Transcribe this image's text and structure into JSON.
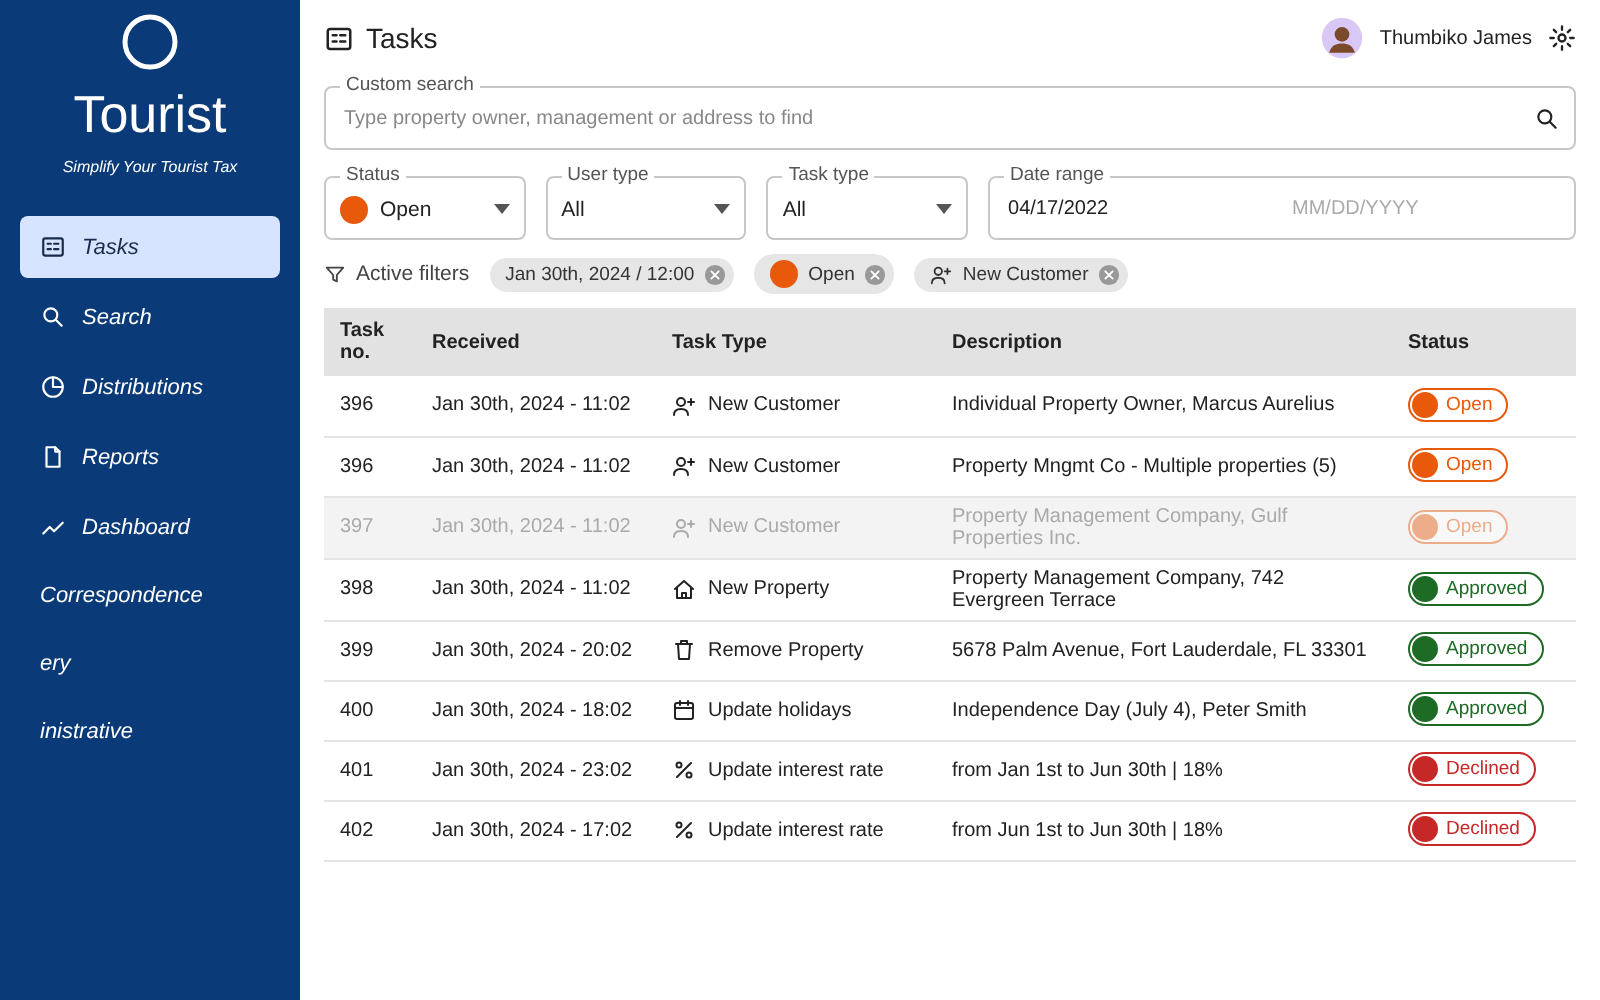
{
  "sidebar": {
    "logo_title": "Tourist",
    "tagline": "Simplify Your Tourist Tax",
    "items": [
      {
        "label": "Tasks",
        "selected": true
      },
      {
        "label": "Search",
        "selected": false
      },
      {
        "label": "Distributions",
        "selected": false
      },
      {
        "label": "Reports",
        "selected": false
      },
      {
        "label": "Dashboard",
        "selected": false
      },
      {
        "label": "Correspondence",
        "selected": false
      },
      {
        "label": "ery",
        "selected": false
      },
      {
        "label": "inistrative",
        "selected": false
      }
    ]
  },
  "page": {
    "title": "Tasks"
  },
  "user": {
    "name": "Thumbiko James"
  },
  "filters": {
    "custom_search": {
      "label": "Custom search",
      "placeholder": "Type property owner, management or address to find"
    },
    "status": {
      "label": "Status",
      "value": "Open",
      "kind": "open"
    },
    "user_type": {
      "label": "User type",
      "value": "All"
    },
    "task_type": {
      "label": "Task type",
      "value": "All"
    },
    "date_range": {
      "label": "Date range",
      "value": "04/17/2022",
      "placeholder": "MM/DD/YYYY"
    }
  },
  "active_filters": {
    "label": "Active filters",
    "chips": [
      {
        "label": "Jan 30th, 2024 / 12:00",
        "kind": "date"
      },
      {
        "label": "Open",
        "kind": "status"
      },
      {
        "label": "New Customer",
        "kind": "user"
      }
    ]
  },
  "table": {
    "columns": [
      "Task no.",
      "Received",
      "Task Type",
      "Description",
      "Status"
    ],
    "rows": [
      {
        "task_no": "396",
        "received": "Jan 30th, 2024 - 11:02",
        "task_type": {
          "kind": "new_customer",
          "label": "New Customer"
        },
        "description": "Individual Property Owner, Marcus Aurelius",
        "status": {
          "kind": "open",
          "label": "Open"
        },
        "disabled": false
      },
      {
        "task_no": "396",
        "received": "Jan 30th, 2024 - 11:02",
        "task_type": {
          "kind": "new_customer",
          "label": "New Customer"
        },
        "description": "Property Mngmt Co - Multiple properties (5)",
        "status": {
          "kind": "open",
          "label": "Open"
        },
        "disabled": false
      },
      {
        "task_no": "397",
        "received": "Jan 30th, 2024 - 11:02",
        "task_type": {
          "kind": "new_customer",
          "label": "New Customer"
        },
        "description": "Property Management Company, Gulf Properties Inc.",
        "status": {
          "kind": "open",
          "label": "Open"
        },
        "disabled": true
      },
      {
        "task_no": "398",
        "received": "Jan 30th, 2024 - 11:02",
        "task_type": {
          "kind": "new_property",
          "label": "New Property"
        },
        "description": "Property Management Company, 742 Evergreen Terrace",
        "status": {
          "kind": "approved",
          "label": "Approved"
        },
        "disabled": false
      },
      {
        "task_no": "399",
        "received": "Jan 30th, 2024 - 20:02",
        "task_type": {
          "kind": "remove_property",
          "label": "Remove Property"
        },
        "description": "5678 Palm Avenue, Fort Lauderdale, FL 33301",
        "status": {
          "kind": "approved",
          "label": "Approved"
        },
        "disabled": false
      },
      {
        "task_no": "400",
        "received": "Jan 30th, 2024 - 18:02",
        "task_type": {
          "kind": "update_holidays",
          "label": "Update holidays"
        },
        "description": "Independence Day (July 4), Peter Smith",
        "status": {
          "kind": "approved",
          "label": "Approved"
        },
        "disabled": false
      },
      {
        "task_no": "401",
        "received": "Jan 30th, 2024 - 23:02",
        "task_type": {
          "kind": "update_interest_rate",
          "label": "Update interest rate"
        },
        "description": "from Jan 1st to Jun 30th | 18%",
        "status": {
          "kind": "declined",
          "label": "Declined"
        },
        "disabled": false
      },
      {
        "task_no": "402",
        "received": "Jan 30th, 2024 - 17:02",
        "task_type": {
          "kind": "update_interest_rate",
          "label": "Update interest rate"
        },
        "description": "from Jun 1st to Jun 30th | 18%",
        "status": {
          "kind": "declined",
          "label": "Declined"
        },
        "disabled": false
      }
    ]
  }
}
